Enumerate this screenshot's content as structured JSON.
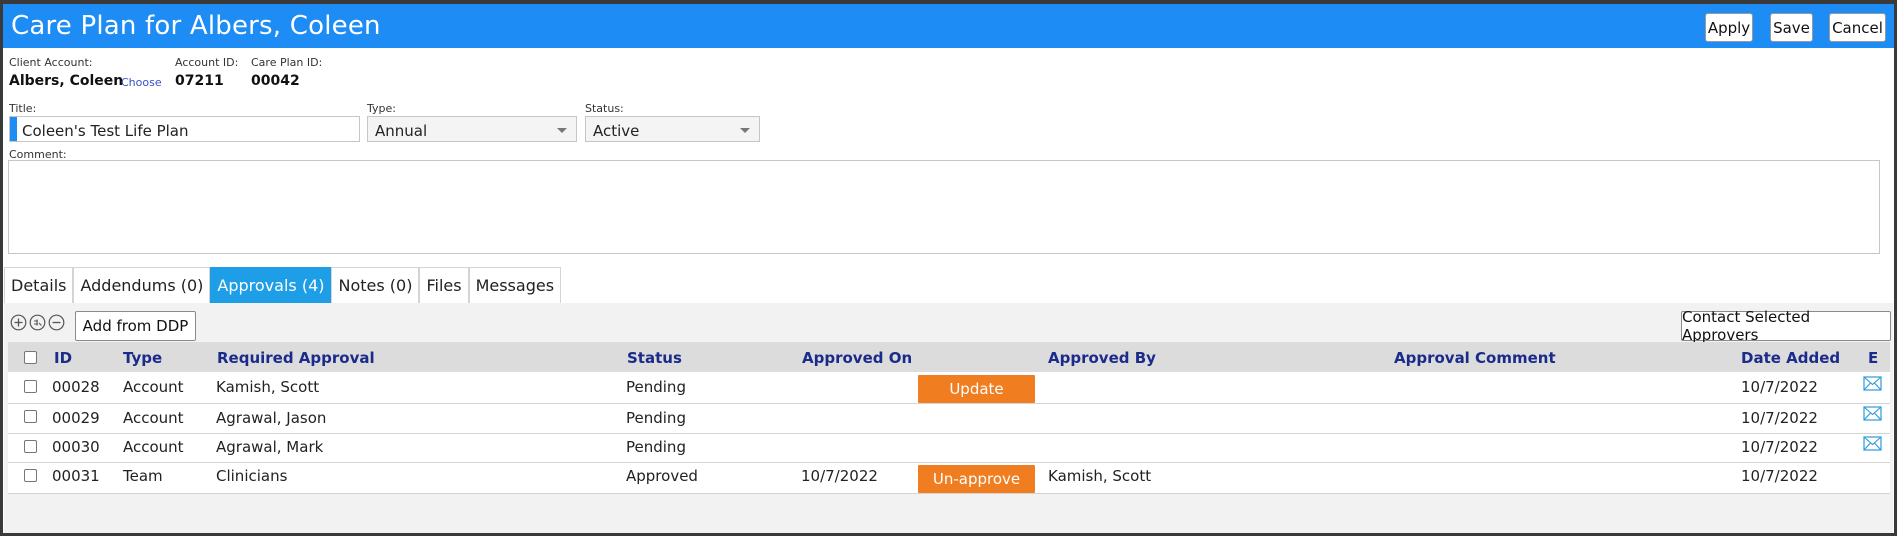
{
  "header": {
    "title": "Care Plan for Albers, Coleen",
    "apply_label": "Apply",
    "save_label": "Save",
    "cancel_label": "Cancel",
    "bg_color": "#1e8cf5"
  },
  "info": {
    "client_account_label": "Client Account:",
    "client_account_value": "Albers, Coleen",
    "choose_label": "Choose",
    "account_id_label": "Account ID:",
    "account_id_value": "07211",
    "care_plan_id_label": "Care Plan ID:",
    "care_plan_id_value": "00042"
  },
  "form": {
    "title_label": "Title:",
    "title_value": "Coleen's Test Life Plan",
    "type_label": "Type:",
    "type_value": "Annual",
    "status_label": "Status:",
    "status_value": "Active",
    "comment_label": "Comment:",
    "comment_value": ""
  },
  "tabs": [
    {
      "label": "Details",
      "active": false
    },
    {
      "label": "Addendums (0)",
      "active": false
    },
    {
      "label": "Approvals (4)",
      "active": true
    },
    {
      "label": "Notes (0)",
      "active": false
    },
    {
      "label": "Files",
      "active": false
    },
    {
      "label": "Messages",
      "active": false
    }
  ],
  "toolbar": {
    "add_icon": "add-circle-icon",
    "link_icon": "link-circle-icon",
    "remove_icon": "remove-circle-icon",
    "add_from_ddp_label": "Add from DDP",
    "contact_label": "Contact Selected Approvers"
  },
  "table": {
    "columns": [
      "ID",
      "Type",
      "Required Approval",
      "Status",
      "Approved On",
      "Approved By",
      "Approval Comment",
      "Date Added",
      "E"
    ],
    "rows": [
      {
        "id": "00028",
        "type": "Account",
        "required": "Kamish, Scott",
        "status": "Pending",
        "approved_on": "",
        "action": "Update",
        "approved_by": "",
        "comment": "",
        "date_added": "10/7/2022",
        "email": true
      },
      {
        "id": "00029",
        "type": "Account",
        "required": "Agrawal, Jason",
        "status": "Pending",
        "approved_on": "",
        "action": "",
        "approved_by": "",
        "comment": "",
        "date_added": "10/7/2022",
        "email": true
      },
      {
        "id": "00030",
        "type": "Account",
        "required": "Agrawal, Mark",
        "status": "Pending",
        "approved_on": "",
        "action": "",
        "approved_by": "",
        "comment": "",
        "date_added": "10/7/2022",
        "email": true
      },
      {
        "id": "00031",
        "type": "Team",
        "required": "Clinicians",
        "status": "Approved",
        "approved_on": "10/7/2022",
        "action": "Un-approve",
        "approved_by": "Kamish, Scott",
        "comment": "",
        "date_added": "10/7/2022",
        "email": false
      }
    ]
  },
  "colors": {
    "accent": "#1e8cf5",
    "active_tab": "#1e9ee6",
    "action_button": "#f07e21",
    "header_text": "#1b2b8a"
  }
}
